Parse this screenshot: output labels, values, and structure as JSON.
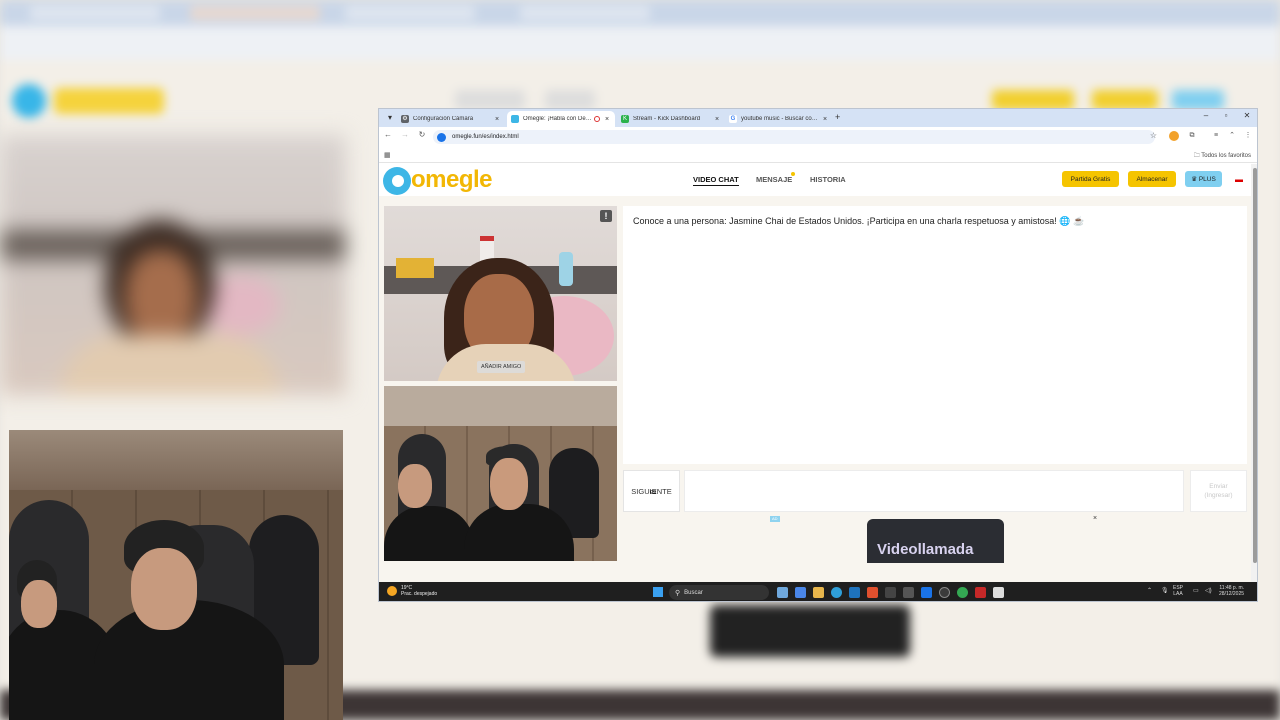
{
  "browser": {
    "tabs": [
      {
        "label": "Configuración Cámara",
        "icon": "gear-icon",
        "color": "#5f6368",
        "active": false
      },
      {
        "label": "Omegle: ¡Habla con Desco",
        "icon": "omegle-icon",
        "color": "#3db6e6",
        "active": true
      },
      {
        "label": "Stream - Kick Dashboard",
        "icon": "kick-icon",
        "color": "#53fc18",
        "active": false
      },
      {
        "label": "youtube music - Buscar con G",
        "icon": "google-icon",
        "color": "#4285f4",
        "active": false
      }
    ],
    "tab_close_glyph": "×",
    "new_tab_glyph": "+",
    "url": "omegle.fun/es/index.html",
    "bookmarks_all": "Todos los favoritos"
  },
  "site": {
    "logo": "omegle",
    "nav": [
      {
        "label": "VIDEO CHAT",
        "active": true
      },
      {
        "label": "MENSAJE",
        "active": false
      },
      {
        "label": "HISTORIA",
        "active": false
      }
    ],
    "buttons": {
      "free_game": "Partida Gratis",
      "store": "Almacenar",
      "plus": "♛ PLUS"
    },
    "accent_yellow": "#f5c400",
    "accent_blue": "#7fcff0"
  },
  "video": {
    "report_glyph": "!",
    "add_friend": "AÑADIR AMIGO"
  },
  "chat": {
    "message": "Conoce a una persona: Jasmine Chai de Estados Unidos. ¡Participa en una charla respetuosa y amistosa! 🌐 ☕",
    "next_button": "SIGUIENTE",
    "send_label": "Enviar",
    "send_hint": "(Ingresar)",
    "input_value": ""
  },
  "ad": {
    "badge": "AD",
    "close": "×",
    "banner_text": "Videollamada"
  },
  "taskbar": {
    "temp": "19°C",
    "weather": "Prac. despejado",
    "search_placeholder": "Buscar",
    "lang_top": "ESP",
    "lang_bottom": "LAA",
    "time": "11:48 p. m.",
    "date": "28/12/2025"
  }
}
